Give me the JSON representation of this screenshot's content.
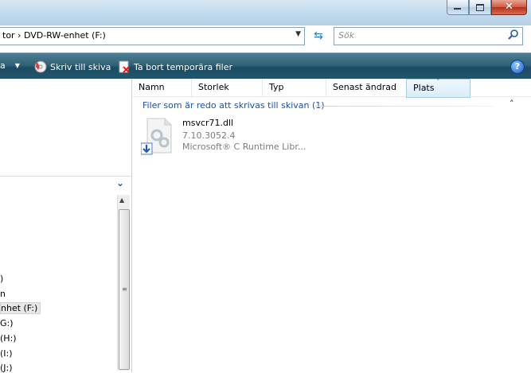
{
  "window": {
    "min_button": "minimize",
    "max_button": "maximize",
    "close_glyph": "✕"
  },
  "address": {
    "path": "tor › DVD-RW-enhet (F:)"
  },
  "search": {
    "placeholder": "Sök"
  },
  "toolbar": {
    "partial_label": "a",
    "burn_label": "Skriv till skiva",
    "delete_temp_label": "Ta bort temporära filer"
  },
  "columns": {
    "name": "Namn",
    "size": "Storlek",
    "type": "Typ",
    "modified": "Senast ändrad",
    "location": "Plats"
  },
  "group": {
    "title": "Filer som är redo att skrivas till skivan (1)"
  },
  "file": {
    "name": "msvcr71.dll",
    "version": "7.10.3052.4",
    "description": "Microsoft® C Runtime Libr..."
  },
  "nav": {
    "items": [
      ")",
      "n",
      "nhet (F:)",
      "G:)",
      " (H:)",
      " (I:)",
      " (J:)"
    ]
  },
  "colors": {
    "toolbar": "#2f6278",
    "group_text": "#1b4fa8",
    "titlebar": "#c1d9ec"
  }
}
